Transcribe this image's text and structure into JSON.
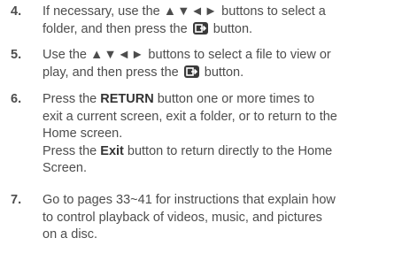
{
  "steps": [
    {
      "number": "4.",
      "lines": [
        {
          "pre": "If necessary, use the ",
          "arrows": "▲▼◄►",
          "post": " buttons to select a"
        },
        {
          "pre": "folder, and then press the ",
          "post": " button."
        }
      ]
    },
    {
      "number": "5.",
      "lines": [
        {
          "pre": "Use the ",
          "arrows": "▲▼◄►",
          "post": " buttons to select a file to view or"
        },
        {
          "pre": "play, and then press the ",
          "post": " button."
        }
      ]
    },
    {
      "number": "6.",
      "para1": {
        "pre": "Press the ",
        "bold": "RETURN",
        "line1_post": " button one or more times to",
        "line2": "exit a current screen, exit a folder, or to return to the",
        "line3": "Home screen."
      },
      "para2": {
        "pre": "Press the ",
        "bold": "Exit",
        "line1_post": " button to return directly to the Home",
        "line2": "Screen."
      }
    },
    {
      "number": "7.",
      "lines_text": [
        "Go to pages 33~41 for instructions that explain how",
        "to control playback of videos, music, and pictures",
        "on a disc."
      ]
    }
  ],
  "icons": {
    "enter": "enter-icon",
    "arrow_color": "#4d4d4d",
    "icon_bg": "#3a3a3a"
  }
}
